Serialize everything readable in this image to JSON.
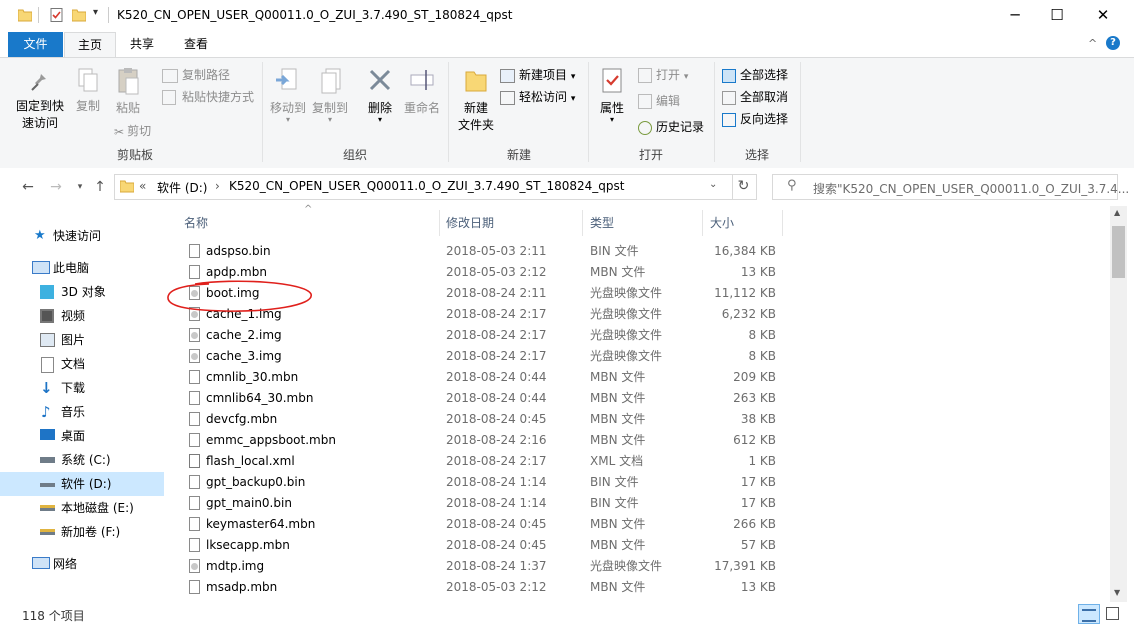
{
  "window": {
    "title": "K520_CN_OPEN_USER_Q00011.0_O_ZUI_3.7.490_ST_180824_qpst",
    "minimize_icon": "minimize-icon",
    "maximize_icon": "maximize-icon",
    "close_icon": "close-icon"
  },
  "ribbon_tabs": {
    "file": "文件",
    "home": "主页",
    "share": "共享",
    "view": "查看"
  },
  "ribbon": {
    "clipboard": {
      "label": "剪贴板",
      "pin": [
        "固定到快",
        "速访问"
      ],
      "copy": "复制",
      "paste": "粘贴",
      "copy_path": "复制路径",
      "paste_shortcut": "粘贴快捷方式",
      "cut": "剪切"
    },
    "organize": {
      "label": "组织",
      "move_to": "移动到",
      "copy_to": "复制到",
      "delete": "删除",
      "rename": "重命名"
    },
    "new": {
      "label": "新建",
      "new_folder": [
        "新建",
        "文件夹"
      ],
      "new_item": "新建项目",
      "easy_access": "轻松访问"
    },
    "open": {
      "label": "打开",
      "properties": "属性",
      "open": "打开",
      "edit": "编辑",
      "history": "历史记录"
    },
    "select": {
      "label": "选择",
      "select_all": "全部选择",
      "select_none": "全部取消",
      "invert": "反向选择"
    }
  },
  "address": {
    "drive": "软件 (D:)",
    "folder": "K520_CN_OPEN_USER_Q00011.0_O_ZUI_3.7.490_ST_180824_qpst",
    "overflow": "«",
    "sep": "›"
  },
  "search": {
    "placeholder": "搜索\"K520_CN_OPEN_USER_Q00011.0_O_ZUI_3.7.4..."
  },
  "nav": [
    {
      "label": "快速访问",
      "icon": "star-icon"
    },
    {
      "label": "此电脑",
      "icon": "computer-icon"
    },
    {
      "label": "3D 对象",
      "icon": "cube-icon"
    },
    {
      "label": "视频",
      "icon": "video-icon"
    },
    {
      "label": "图片",
      "icon": "picture-icon"
    },
    {
      "label": "文档",
      "icon": "document-icon"
    },
    {
      "label": "下载",
      "icon": "download-icon"
    },
    {
      "label": "音乐",
      "icon": "music-icon"
    },
    {
      "label": "桌面",
      "icon": "desktop-icon"
    },
    {
      "label": "系统 (C:)",
      "icon": "drive-icon"
    },
    {
      "label": "软件 (D:)",
      "icon": "drive-icon"
    },
    {
      "label": "本地磁盘 (E:)",
      "icon": "drive-icon"
    },
    {
      "label": "新加卷 (F:)",
      "icon": "drive-icon"
    },
    {
      "label": "网络",
      "icon": "network-icon"
    }
  ],
  "columns": {
    "name": "名称",
    "date": "修改日期",
    "type": "类型",
    "size": "大小"
  },
  "files": [
    {
      "name": "adspso.bin",
      "date": "2018-05-03 2:11",
      "type": "BIN 文件",
      "size": "16,384 KB",
      "icon": "bin"
    },
    {
      "name": "apdp.mbn",
      "date": "2018-05-03 2:12",
      "type": "MBN 文件",
      "size": "13 KB",
      "icon": "bin"
    },
    {
      "name": "boot.img",
      "date": "2018-08-24 2:11",
      "type": "光盘映像文件",
      "size": "11,112 KB",
      "icon": "img"
    },
    {
      "name": "cache_1.img",
      "date": "2018-08-24 2:17",
      "type": "光盘映像文件",
      "size": "6,232 KB",
      "icon": "img"
    },
    {
      "name": "cache_2.img",
      "date": "2018-08-24 2:17",
      "type": "光盘映像文件",
      "size": "8 KB",
      "icon": "img"
    },
    {
      "name": "cache_3.img",
      "date": "2018-08-24 2:17",
      "type": "光盘映像文件",
      "size": "8 KB",
      "icon": "img"
    },
    {
      "name": "cmnlib_30.mbn",
      "date": "2018-08-24 0:44",
      "type": "MBN 文件",
      "size": "209 KB",
      "icon": "bin"
    },
    {
      "name": "cmnlib64_30.mbn",
      "date": "2018-08-24 0:44",
      "type": "MBN 文件",
      "size": "263 KB",
      "icon": "bin"
    },
    {
      "name": "devcfg.mbn",
      "date": "2018-08-24 0:45",
      "type": "MBN 文件",
      "size": "38 KB",
      "icon": "bin"
    },
    {
      "name": "emmc_appsboot.mbn",
      "date": "2018-08-24 2:16",
      "type": "MBN 文件",
      "size": "612 KB",
      "icon": "bin"
    },
    {
      "name": "flash_local.xml",
      "date": "2018-08-24 2:17",
      "type": "XML 文档",
      "size": "1 KB",
      "icon": "xml"
    },
    {
      "name": "gpt_backup0.bin",
      "date": "2018-08-24 1:14",
      "type": "BIN 文件",
      "size": "17 KB",
      "icon": "bin"
    },
    {
      "name": "gpt_main0.bin",
      "date": "2018-08-24 1:14",
      "type": "BIN 文件",
      "size": "17 KB",
      "icon": "bin"
    },
    {
      "name": "keymaster64.mbn",
      "date": "2018-08-24 0:45",
      "type": "MBN 文件",
      "size": "266 KB",
      "icon": "bin"
    },
    {
      "name": "lksecapp.mbn",
      "date": "2018-08-24 0:45",
      "type": "MBN 文件",
      "size": "57 KB",
      "icon": "bin"
    },
    {
      "name": "mdtp.img",
      "date": "2018-08-24 1:37",
      "type": "光盘映像文件",
      "size": "17,391 KB",
      "icon": "img"
    },
    {
      "name": "msadp.mbn",
      "date": "2018-05-03 2:12",
      "type": "MBN 文件",
      "size": "13 KB",
      "icon": "bin"
    }
  ],
  "status": {
    "count": "118 个项目"
  },
  "colors": {
    "accent": "#1979ca",
    "selection": "#cce8ff",
    "annotation": "#e0201c"
  }
}
